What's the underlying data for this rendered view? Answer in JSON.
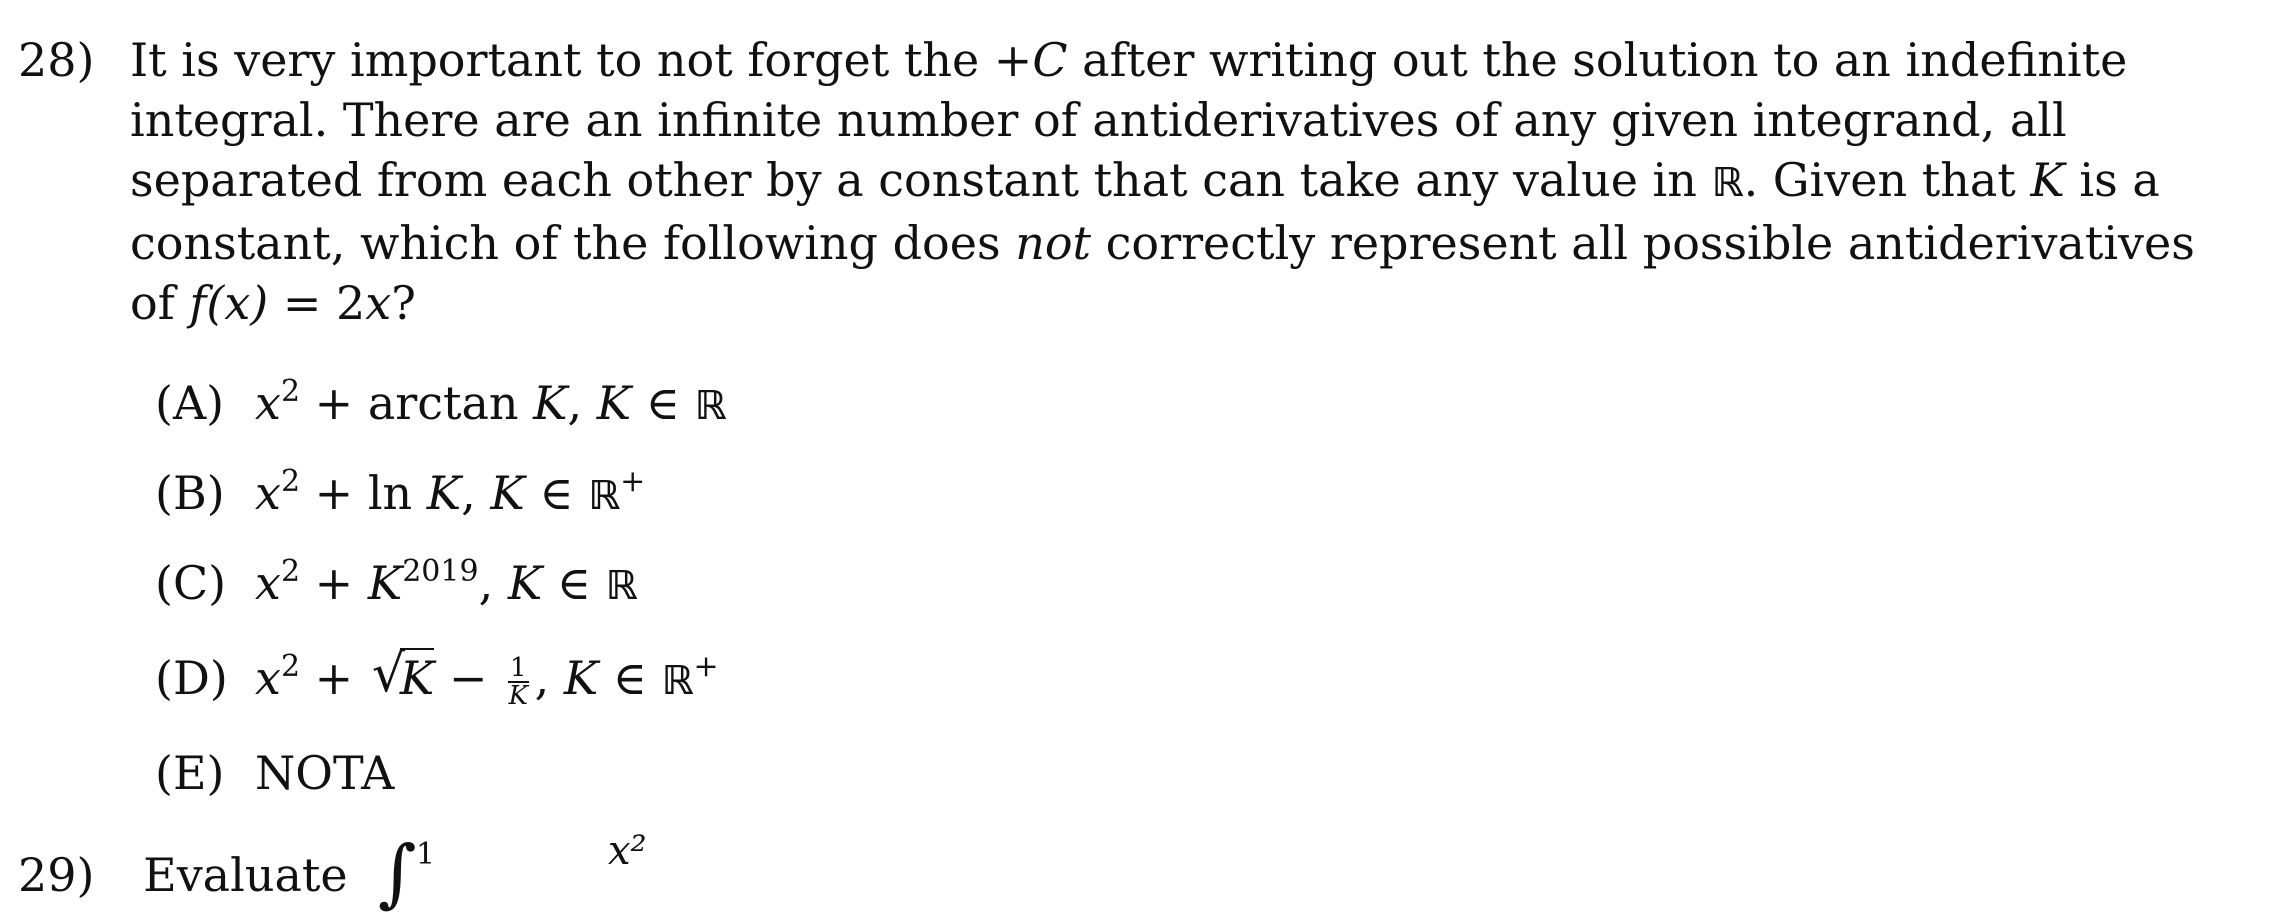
{
  "question": {
    "number": "28)",
    "lines": [
      "It is very important to not forget the +C after writing out the solution to an indefinite",
      "integral.  There are an infinite number of antiderivatives of any given integrand, all",
      "separated from each other by a constant that can take any value in ℝ. Given that K is a",
      "constant, which of the following does not correctly represent all possible antiderivatives",
      "of f(x) = 2x?"
    ],
    "line1_a": "It is very important to not forget the +",
    "line1_c": "C",
    "line1_b": " after writing out the solution to an indefinite",
    "line2": "integral.  There are an infinite number of antiderivatives of any given integrand, all",
    "line3_a": "separated from each other by a constant that can take any value in ",
    "line3_r": "ℝ",
    "line3_b": ". Given that ",
    "line3_k": "K",
    "line3_c": " is a",
    "line4_a": "constant, which of the following does ",
    "line4_not": "not",
    "line4_b": " correctly represent all possible antiderivatives",
    "line5_a": "of ",
    "line5_fx": "f(x)",
    "line5_b": " = 2",
    "line5_x": "x",
    "line5_c": "?"
  },
  "options": [
    {
      "label": "(A)",
      "text": "x² + arctan K, K ∈ ℝ"
    },
    {
      "label": "(B)",
      "text": "x² + ln K, K ∈ ℝ⁺"
    },
    {
      "label": "(C)",
      "text": "x² + K²⁰¹⁹, K ∈ ℝ"
    },
    {
      "label": "(D)",
      "text": "x² + √K − 1/K, K ∈ ℝ⁺"
    },
    {
      "label": "(E)",
      "text": "NOTA"
    }
  ],
  "next_question": {
    "number": "29)",
    "start": "Evaluate",
    "upper_limit": "1",
    "numerator": "x²"
  }
}
